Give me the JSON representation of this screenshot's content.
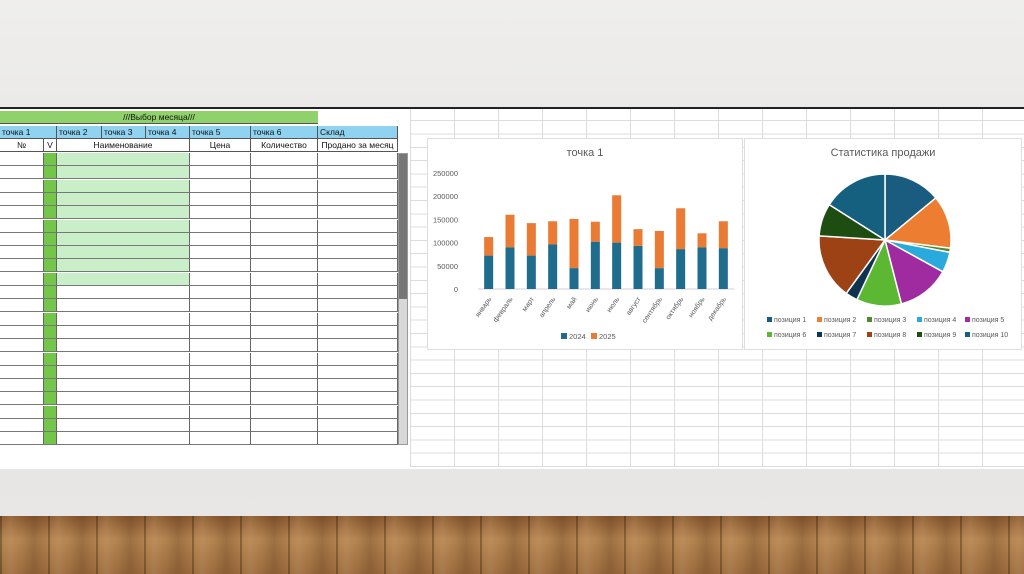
{
  "sheet": {
    "month_selector": "///Выбор месяца///",
    "points": [
      "точка 1",
      "точка 2",
      "точка 3",
      "точка 4",
      "точка 5",
      "точка 6",
      "Склад"
    ],
    "columns": [
      "№",
      "V",
      "Наименование",
      "Цена",
      "Количество",
      "Продано за месяц"
    ],
    "empty_rows": 22
  },
  "colors": {
    "header_green": "#8fd16b",
    "header_blue": "#8fd3f1",
    "v_column": "#74c64b",
    "name_highlight": "#c8efc8",
    "series_2024": "#1f6c8c",
    "series_2025": "#e97b35"
  },
  "chart_data": [
    {
      "type": "bar",
      "stacked": true,
      "title": "точка 1",
      "categories": [
        "январь",
        "февраль",
        "март",
        "апрель",
        "май",
        "июнь",
        "июль",
        "август",
        "сентябрь",
        "октябрь",
        "ноябрь",
        "декабрь"
      ],
      "series": [
        {
          "name": "2024",
          "color": "#1f6c8c",
          "values": [
            72000,
            90000,
            72000,
            96000,
            45000,
            102000,
            100000,
            93000,
            45000,
            86000,
            90000,
            88000
          ]
        },
        {
          "name": "2025",
          "color": "#e97b35",
          "values": [
            40000,
            70000,
            70000,
            50000,
            106000,
            43000,
            102000,
            36000,
            80000,
            88000,
            30000,
            58000
          ]
        }
      ],
      "ylim": [
        0,
        250000
      ],
      "yticks": [
        "0",
        "50000",
        "100000",
        "150000",
        "200000",
        "250000"
      ],
      "legend": "bottom",
      "grid": false
    },
    {
      "type": "pie",
      "title": "Статистика продажи",
      "labels": [
        "позиция 1",
        "позиция 2",
        "позиция 3",
        "позиция 4",
        "позиция 5",
        "позиция 6",
        "позиция 7",
        "позиция 8",
        "позиция 9",
        "позиция 10"
      ],
      "values": [
        14,
        13,
        1,
        5,
        13,
        11,
        3,
        16,
        8,
        16
      ],
      "colors": [
        "#1a5b80",
        "#ed7d31",
        "#4d8a2a",
        "#2aa9dc",
        "#a02ba0",
        "#5cb832",
        "#10344f",
        "#9c4214",
        "#1e4d12",
        "#15607f"
      ],
      "legend": "bottom"
    }
  ]
}
